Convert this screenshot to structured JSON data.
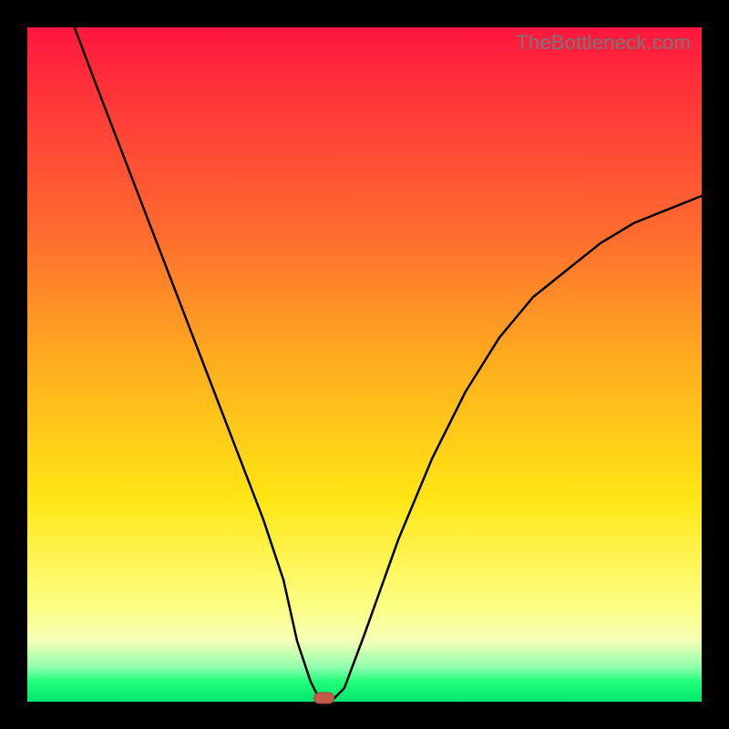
{
  "watermark": "TheBottleneck.com",
  "colors": {
    "gradient_top": "#ff163f",
    "gradient_mid1": "#ff6a2f",
    "gradient_mid2": "#ffe614",
    "gradient_mid3": "#fcff85",
    "gradient_bottom": "#04e56e",
    "frame": "#000000",
    "curve": "#000000",
    "notch": "#c55a4a"
  },
  "chart_data": {
    "type": "line",
    "title": "",
    "xlabel": "",
    "ylabel": "",
    "xlim": [
      0,
      100
    ],
    "ylim": [
      0,
      100
    ],
    "grid": false,
    "series": [
      {
        "name": "bottleneck-curve",
        "x": [
          7,
          10,
          15,
          20,
          25,
          30,
          35,
          38,
          40,
          42,
          43,
          44,
          45,
          47,
          50,
          55,
          60,
          65,
          70,
          75,
          80,
          85,
          90,
          95,
          100
        ],
        "y": [
          100,
          92,
          79,
          66,
          53,
          40,
          27,
          18,
          9,
          3,
          1,
          0,
          0,
          2,
          10,
          24,
          36,
          46,
          54,
          60,
          64,
          68,
          71,
          73,
          75
        ]
      }
    ],
    "annotations": [
      {
        "name": "min-notch",
        "x": 44,
        "y": 0
      }
    ]
  }
}
